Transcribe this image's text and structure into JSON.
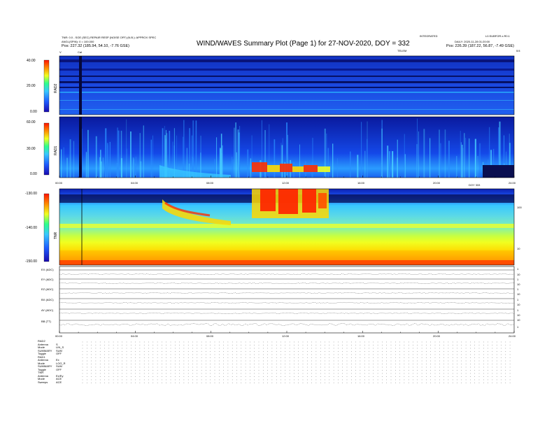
{
  "header": {
    "title": "WIND/WAVES Summary Plot (Page 1) for 27-NOV-2020, DOY = 332",
    "left_line1": "TNR: 0.0 - SOE (SEC) REPAIR RESP (NOISE OFF) (N.B.): APPROX SPEC",
    "left_line2": "ANGL(SPIN): 0 = 100.000",
    "left_pos_label": "Pos:",
    "left_pos_value": "227.32 (185.94, 54.10, -7.76 GSE)",
    "right_line1_a": "INTEGRATED",
    "right_line1_b": "L0.SUBFOR.x.R0.1",
    "right_line2": "DAILY: 2020-11-28 01:20:00",
    "right_pos_label": "Pos:",
    "right_pos_value": "226.39 (187.22, 56.87, -7.49 GSE)",
    "cal_label": "Cal",
    "mid_label": "TELEM",
    "v_left": "V",
    "v_right": "0/4"
  },
  "chart_data": [
    {
      "type": "heatmap",
      "name": "RAD2",
      "ylabel": "RAD2",
      "y_ticks": [
        "40.00",
        "20.00",
        "0.00"
      ],
      "ylim": [
        0,
        40
      ]
    },
    {
      "type": "heatmap",
      "name": "RAD1",
      "ylabel": "RAD1",
      "y_ticks": [
        "60.00",
        "30.00",
        "0.00"
      ],
      "ylim": [
        0,
        60
      ],
      "x_ticks": [
        "00:00",
        "04:00",
        "08:00",
        "12:00",
        "16:00",
        "20:00",
        "24:00"
      ],
      "x_note": "DOY 333"
    },
    {
      "type": "heatmap",
      "name": "TNR",
      "ylabel": "TNR",
      "y_ticks": [
        "-130.00",
        "-140.00",
        "-150.00"
      ],
      "ylim": [
        -150,
        -130
      ],
      "right_ticks": [
        "100",
        "10"
      ]
    },
    {
      "type": "line",
      "name": "housekeeping",
      "rows": [
        "EX (ADC)",
        "EY (ADC)",
        "EZ (ADC)",
        "BX (ADC)",
        "AY (ADC)",
        "BB (TT)"
      ],
      "right_ticks": [
        [
          "1",
          "10"
        ],
        [
          "1",
          "10"
        ],
        [
          "1",
          "10"
        ],
        [
          "1",
          "10"
        ],
        [
          "1",
          "10"
        ],
        [
          "10",
          "1"
        ]
      ],
      "x_ticks": [
        "00:00",
        "04:00",
        "08:00",
        "12:00",
        "16:00",
        "20:00",
        "24:00"
      ]
    }
  ],
  "footer": {
    "rad2_header": "RAD2",
    "rad2": [
      {
        "k": "Antenna",
        "v": "S"
      },
      {
        "k": "Mode",
        "v": "LIN_S"
      },
      {
        "k": "SUMMARY",
        "v": "SUM"
      },
      {
        "k": "Toggle",
        "v": "OFF"
      }
    ],
    "rad1_header": "RAD1",
    "rad1": [
      {
        "k": "Antenna",
        "v": "Ex"
      },
      {
        "k": "Mode",
        "v": "LOG_R"
      },
      {
        "k": "SUMMARY",
        "v": "SUM"
      },
      {
        "k": "Toggle",
        "v": "OFF"
      }
    ],
    "tnr_header": "TNR",
    "tnr": [
      {
        "k": "Antenna",
        "v": "Ex/Ey"
      },
      {
        "k": "Mode",
        "v": "ACE"
      },
      {
        "k": "Sweeps",
        "v": "ACE"
      }
    ]
  },
  "colors": {
    "bg_dark": "#0c1fb0",
    "mid_blue": "#1e5cff",
    "cyan": "#38c8ff",
    "green": "#2cff8c",
    "yellow": "#f0ff20",
    "orange": "#ff8a00",
    "red": "#ff1400"
  }
}
